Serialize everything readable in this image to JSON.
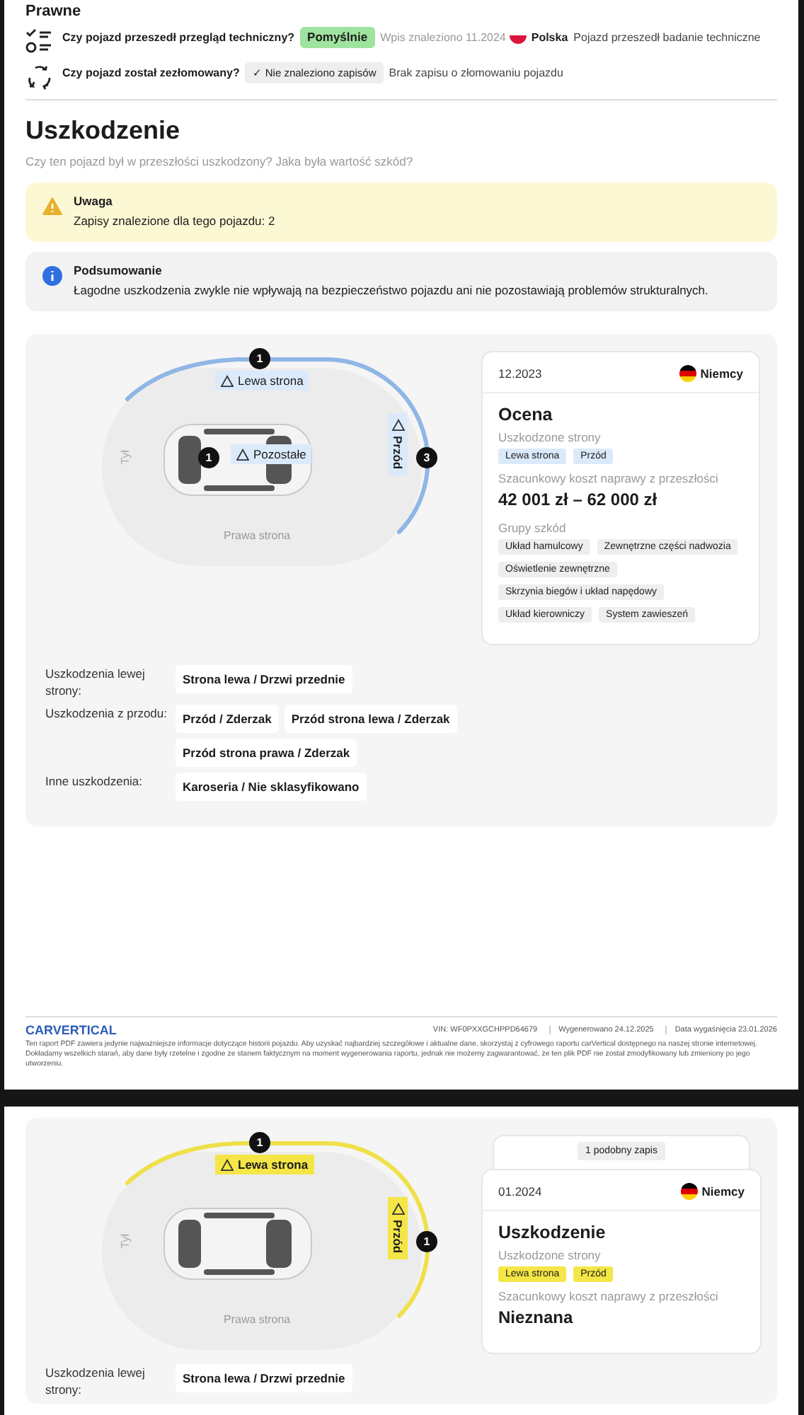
{
  "page_1": {
    "section_heading": "Prawne",
    "checks": [
      {
        "kind": "inspection",
        "question": "Czy pojazd przeszedł przegląd techniczny?",
        "badge": "Pomyślnie",
        "passed": true,
        "found": "Wpis znaleziono 11.2024",
        "country": "Polska",
        "description": "Pojazd przeszedł badanie techniczne"
      },
      {
        "kind": "scrap",
        "question": "Czy pojazd został zezłomowany?",
        "badge_icon": "✓",
        "badge": "Nie znaleziono zapisów",
        "passed": false,
        "description": "Brak zapisu o złomowaniu pojazdu"
      }
    ],
    "title": "Uszkodzenie",
    "subtitle": "Czy ten pojazd był w przeszłości uszkodzony? Jaka była wartość szkód?",
    "alerts": [
      {
        "kind": "warning",
        "title": "Uwaga",
        "text": "Zapisy znalezione dla tego pojazdu: 2"
      },
      {
        "kind": "info",
        "title": "Podsumowanie",
        "text": "Łagodne uszkodzenia zwykle nie wpływają na bezpieczeństwo pojazdu ani nie pozostawiają problemów strukturalnych."
      }
    ],
    "record": {
      "kind": "assessment",
      "rear_label": "Tył",
      "right_label": "Prawa strona",
      "zones": [
        {
          "kind": "left",
          "label": "Lewa strona",
          "count": "1"
        },
        {
          "kind": "other",
          "label": "Pozostałe",
          "count": "1"
        },
        {
          "kind": "front",
          "label": "Przód",
          "count": "3"
        }
      ],
      "details": [
        {
          "label": "Uszkodzenia lewej strony:",
          "items": [
            "Strona lewa / Drzwi przednie"
          ]
        },
        {
          "label": "Uszkodzenia z przodu:",
          "items": [
            "Przód / Zderzak",
            "Przód strona lewa / Zderzak",
            "Przód strona prawa / Zderzak"
          ]
        },
        {
          "label": "Inne uszkodzenia:",
          "items": [
            "Karoseria / Nie sklasyfikowano"
          ]
        }
      ],
      "card": {
        "date": "12.2023",
        "country": "Niemcy",
        "title": "Ocena",
        "sides_label": "Uszkodzone strony",
        "sides": [
          "Lewa strona",
          "Przód"
        ],
        "cost_label": "Szacunkowy koszt naprawy z przeszłości",
        "cost": "42 001 zł – 62 000 zł",
        "groups_label": "Grupy szkód",
        "groups": [
          "Układ hamulcowy",
          "Zewnętrzne części nadwozia",
          "Oświetlenie zewnętrzne",
          "Skrzynia biegów i układ napędowy",
          "Układ kierowniczy",
          "System zawieszeń"
        ]
      }
    },
    "footer": {
      "logo": "CARVERTICAL",
      "vin": "VIN: WF0PXXGCHPPD64679",
      "generated": "Wygenerowano 24.12.2025",
      "expires": "Data wygaśnięcia 23.01.2026",
      "disclaimer": "Ten raport PDF zawiera jedynie najważniejsze informacje dotyczące historii pojazdu. Aby uzyskać najbardziej szczegółowe i aktualne dane, skorzystaj z cyfrowego raportu carVertical dostępnego na naszej stronie internetowej. Dokładamy wszelkich starań, aby dane były rzetelne i zgodne ze stanem faktycznym na moment wygenerowania raportu, jednak nie możemy zagwarantować, że ten plik PDF nie został zmodyfikowany lub zmieniony po jego utworzeniu."
    }
  },
  "page_2": {
    "record": {
      "kind": "damage",
      "rear_label": "Tył",
      "right_label": "Prawa strona",
      "zones": [
        {
          "kind": "left",
          "label": "Lewa strona",
          "count": "1"
        },
        {
          "kind": "front",
          "label": "Przód",
          "count": "1"
        }
      ],
      "details": [
        {
          "label": "Uszkodzenia lewej strony:",
          "items": [
            "Strona lewa / Drzwi przednie"
          ]
        }
      ],
      "card": {
        "similar": "1 podobny zapis",
        "date": "01.2024",
        "country": "Niemcy",
        "title": "Uszkodzenie",
        "sides_label": "Uszkodzone strony",
        "sides": [
          "Lewa strona",
          "Przód"
        ],
        "cost_label": "Szacunkowy koszt naprawy z przeszłości",
        "cost": "Nieznana"
      }
    }
  }
}
